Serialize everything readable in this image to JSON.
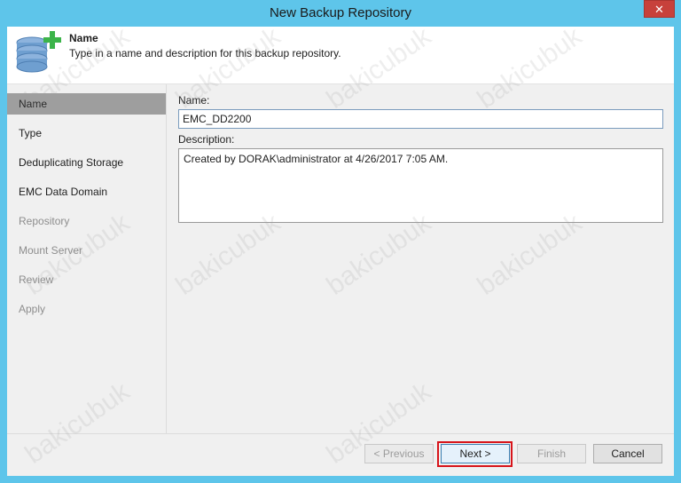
{
  "window": {
    "title": "New Backup Repository",
    "close_glyph": "✕"
  },
  "header": {
    "icon": "database-add-icon",
    "title": "Name",
    "description": "Type in a name and description for this backup repository."
  },
  "steps": [
    {
      "label": "Name",
      "state": "active"
    },
    {
      "label": "Type",
      "state": "enabled"
    },
    {
      "label": "Deduplicating Storage",
      "state": "enabled"
    },
    {
      "label": "EMC Data Domain",
      "state": "enabled"
    },
    {
      "label": "Repository",
      "state": "disabled"
    },
    {
      "label": "Mount Server",
      "state": "disabled"
    },
    {
      "label": "Review",
      "state": "disabled"
    },
    {
      "label": "Apply",
      "state": "disabled"
    }
  ],
  "form": {
    "name_label": "Name:",
    "name_value": "EMC_DD2200",
    "description_label": "Description:",
    "description_value": "Created by DORAK\\administrator at 4/26/2017 7:05 AM."
  },
  "buttons": {
    "previous": "< Previous",
    "next": "Next >",
    "finish": "Finish",
    "cancel": "Cancel"
  },
  "watermark": "bakicubuk",
  "colors": {
    "titlebar": "#5ec5ea",
    "close": "#c7413b",
    "highlight": "#d7141a",
    "icon_green": "#3cb44a",
    "icon_blue": "#6f9fd0"
  }
}
